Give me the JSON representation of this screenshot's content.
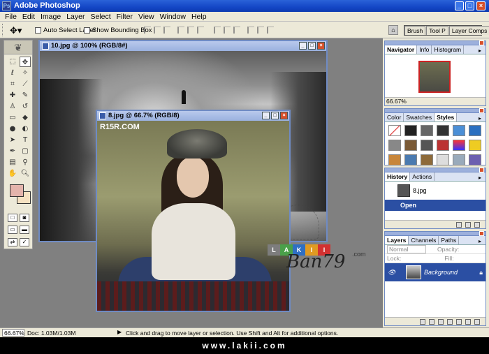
{
  "window": {
    "title": "Adobe Photoshop"
  },
  "menu": [
    "File",
    "Edit",
    "Image",
    "Layer",
    "Select",
    "Filter",
    "View",
    "Window",
    "Help"
  ],
  "options": {
    "auto_select_label": "Auto Select Layer",
    "bounding_box_label": "Show Bounding Box",
    "well_tabs": [
      "Brush",
      "Tool P",
      "Layer Comps"
    ]
  },
  "documents": {
    "doc1": {
      "title": "10.jpg @ 100% (RGB/8#)"
    },
    "doc2": {
      "title": "8.jpg @ 66.7% (RGB/8)",
      "watermark": "R15R.COM"
    }
  },
  "overlay": {
    "logo_letters": [
      "L",
      "A",
      "K",
      "I",
      "I"
    ],
    "com": ".com",
    "signature": "Ban79"
  },
  "panels": {
    "navigator": {
      "tabs": [
        "Navigator",
        "Info",
        "Histogram"
      ],
      "zoom": "66.67%"
    },
    "styles": {
      "tabs": [
        "Color",
        "Swatches",
        "Styles"
      ]
    },
    "history": {
      "tabs": [
        "History",
        "Actions"
      ],
      "snapshot": "8.jpg",
      "state": "Open"
    },
    "layers": {
      "tabs": [
        "Layers",
        "Channels",
        "Paths"
      ],
      "blend": "Normal",
      "opacity_label": "Opacity:",
      "lock_label": "Lock:",
      "fill_label": "Fill:",
      "layer_name": "Background"
    }
  },
  "status": {
    "zoom": "66.67%",
    "doc_size": "Doc: 1.03M/1.03M",
    "hint": "Click and drag to move layer or selection.  Use Shift and Alt for additional options."
  },
  "footer": "www.lakii.com",
  "colors": {
    "accent": "#2b4fa3",
    "foreground": "#e4b4ac",
    "background": "#f6e2c2"
  }
}
